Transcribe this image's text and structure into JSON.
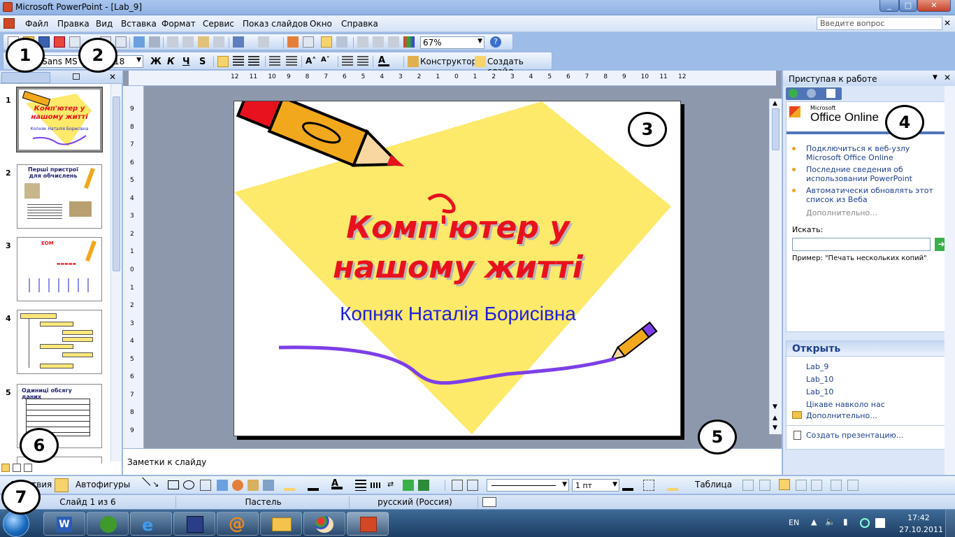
{
  "window": {
    "title": "Microsoft PowerPoint - [Lab_9]",
    "controls": [
      "_",
      "□",
      "✕"
    ]
  },
  "menu": {
    "items": [
      "Файл",
      "Правка",
      "Вид",
      "Вставка",
      "Формат",
      "Сервис",
      "Показ слайдов",
      "Окно",
      "Справка"
    ],
    "help_placeholder": "Введите вопрос"
  },
  "toolbar": {
    "zoom": "67%",
    "font": "Comic Sans MS",
    "font_size": "18",
    "bold": "Ж",
    "italic": "К",
    "underline": "Ч",
    "shadow": "S",
    "designer_label": "Конструктор",
    "new_slide_label": "Создать слайд"
  },
  "ruler": {
    "h_ticks": [
      "12",
      "11",
      "10",
      "9",
      "8",
      "7",
      "6",
      "5",
      "4",
      "3",
      "2",
      "1",
      "0",
      "1",
      "2",
      "3",
      "4",
      "5",
      "6",
      "7",
      "8",
      "9",
      "10",
      "11",
      "12"
    ],
    "v_ticks": [
      "9",
      "8",
      "7",
      "6",
      "5",
      "4",
      "3",
      "2",
      "1",
      "0",
      "1",
      "2",
      "3",
      "4",
      "5",
      "6",
      "7",
      "8",
      "9"
    ]
  },
  "slides_panel": {
    "slides": [
      {
        "num": "1",
        "title": "Комп'ютер у нашому житті",
        "sub": "Копняк Наталія Борисівна"
      },
      {
        "num": "2",
        "title": "Перші пристрої для обчислень"
      },
      {
        "num": "3",
        "title": "ЕОМ"
      },
      {
        "num": "4",
        "title": ""
      },
      {
        "num": "5",
        "title": "Одиниці обсягу даних"
      }
    ]
  },
  "slide": {
    "title_line1": "Комп'ютер  у",
    "title_line2": "нашому  житті",
    "subtitle": "Копняк Наталія Борисівна"
  },
  "notes": {
    "placeholder": "Заметки к слайду"
  },
  "taskpane": {
    "title": "Приступая к работе",
    "office_small": "Microsoft",
    "office_big": "Office Online",
    "links": [
      "Подключиться к веб-узлу Microsoft Office Online",
      "Последние сведения об использовании PowerPoint",
      "Автоматически обновлять этот список из Веба"
    ],
    "more_link": "Дополнительно...",
    "search_label": "Искать:",
    "example": "Пример:  \"Печать нескольких копий\"",
    "open_header": "Открыть",
    "recent": [
      "Lab_9",
      "Lab_10",
      "Lab_10",
      "Цікаве навколо нас"
    ],
    "open_more": "Дополнительно...",
    "create": "Создать презентацию..."
  },
  "drawbar": {
    "actions": "Действия",
    "autoshapes": "Автофигуры",
    "line_width": "1 пт",
    "table": "Таблица"
  },
  "status": {
    "slide_of": "Слайд 1 из 6",
    "design": "Пастель",
    "language": "русский (Россия)"
  },
  "taskbar": {
    "lang": "EN",
    "time": "17:42",
    "date": "27.10.2011"
  },
  "callouts": [
    "1",
    "2",
    "3",
    "4",
    "5",
    "6",
    "7"
  ],
  "colors": {
    "slide_title": "#e8121e",
    "slide_subtitle": "#1f1fd8",
    "diamond": "#fde96a",
    "wave": "#7d3fe8"
  }
}
